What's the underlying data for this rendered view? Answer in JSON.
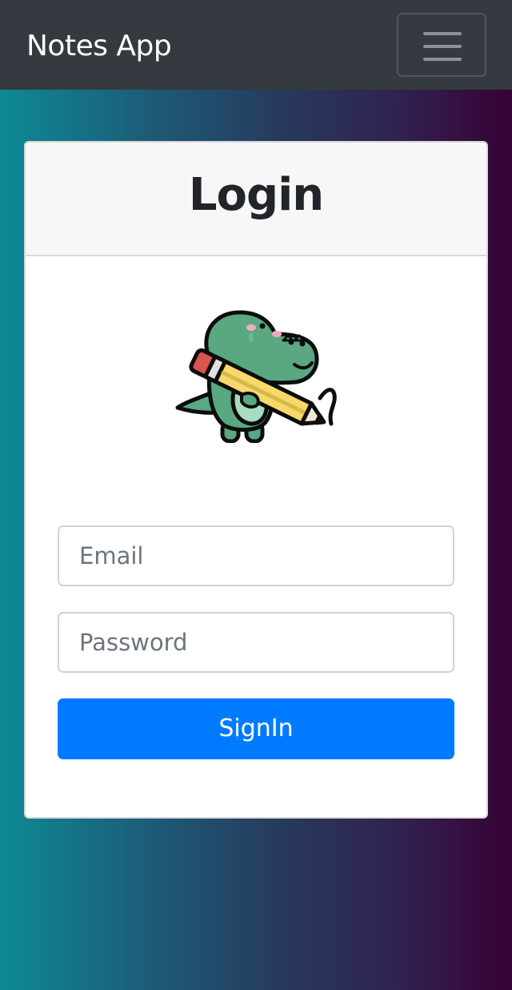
{
  "navbar": {
    "brand": "Notes App",
    "menu_icon": "hamburger-menu-icon"
  },
  "login": {
    "title": "Login",
    "illustration": "dinosaur-holding-pencil",
    "email_placeholder": "Email",
    "password_placeholder": "Password",
    "submit_label": "SignIn"
  },
  "colors": {
    "navbar_bg": "#343a40",
    "gradient_start": "#0e8a94",
    "gradient_end": "#360233",
    "primary_button": "#007bff",
    "card_header_bg": "#f7f7f7"
  }
}
